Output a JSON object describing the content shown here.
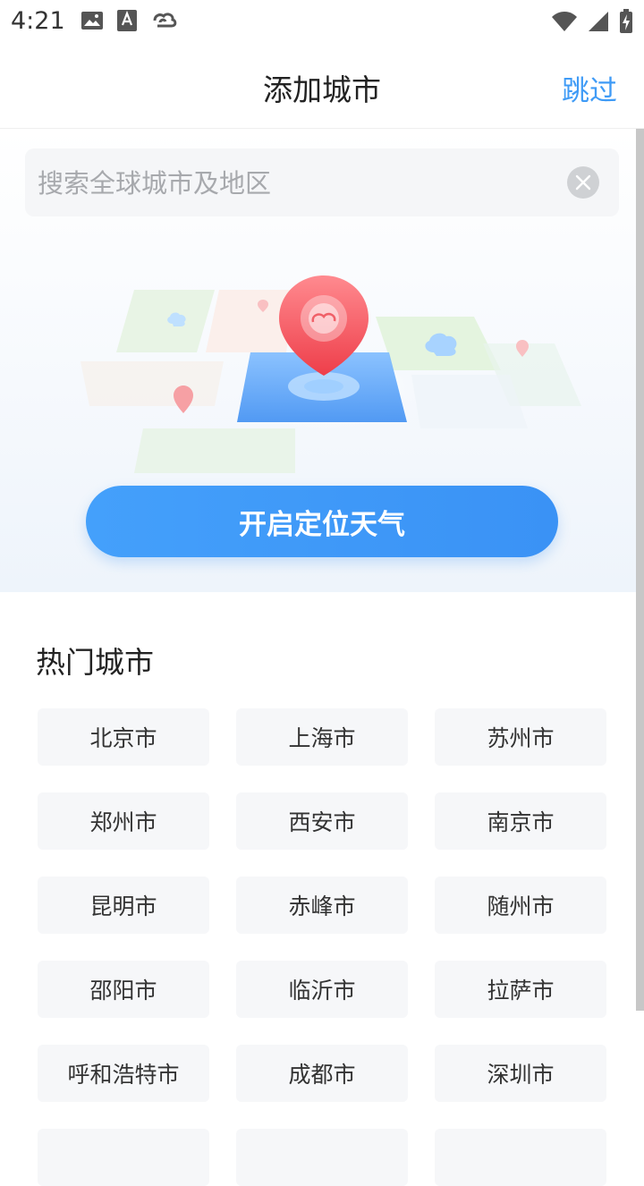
{
  "status_bar": {
    "time": "4:21",
    "left_icons": [
      "image-icon",
      "a-badge-icon",
      "cloud-cycle-icon"
    ],
    "right_icons": [
      "wifi-icon",
      "signal-icon",
      "battery-charging-icon"
    ]
  },
  "header": {
    "title": "添加城市",
    "skip_label": "跳过"
  },
  "search": {
    "placeholder": "搜索全球城市及地区",
    "clear_icon": "close-circle-icon"
  },
  "illustration": {
    "icon": "location-pin-map-icon"
  },
  "locate_button": {
    "label": "开启定位天气"
  },
  "hot_cities": {
    "title": "热门城市",
    "cities": [
      "北京市",
      "上海市",
      "苏州市",
      "郑州市",
      "西安市",
      "南京市",
      "昆明市",
      "赤峰市",
      "随州市",
      "邵阳市",
      "临沂市",
      "拉萨市",
      "呼和浩特市",
      "成都市",
      "深圳市",
      "",
      "",
      ""
    ]
  },
  "colors": {
    "accent": "#3f9bf6",
    "button_gradient_start": "#44a0fb",
    "button_gradient_end": "#3a92f5",
    "pin_red": "#f0505a",
    "chip_bg": "#f6f7f9"
  }
}
